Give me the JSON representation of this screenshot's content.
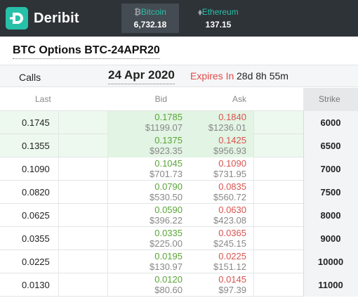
{
  "app": {
    "brand": "Deribit"
  },
  "tabs": [
    {
      "symbol": "₿",
      "label": "Bitcoin",
      "price": "6,732.18",
      "active": true
    },
    {
      "symbol": "⬧",
      "label": "Ethereum",
      "price": "137.15",
      "active": false
    }
  ],
  "page_title": "BTC Options BTC-24APR20",
  "expiry": {
    "side_label": "Calls",
    "date": "24 Apr 2020",
    "expires_in_label": "Expires In",
    "countdown": "28d 8h 55m"
  },
  "table": {
    "headers": {
      "last": "Last",
      "bid": "Bid",
      "ask": "Ask",
      "strike": "Strike"
    },
    "rows": [
      {
        "last": "0.1745",
        "bid": "0.1785",
        "bid_usd": "$1199.07",
        "ask": "0.1840",
        "ask_usd": "$1236.01",
        "strike": "6000",
        "in_the_money": true
      },
      {
        "last": "0.1355",
        "bid": "0.1375",
        "bid_usd": "$923.35",
        "ask": "0.1425",
        "ask_usd": "$956.93",
        "strike": "6500",
        "in_the_money": true
      },
      {
        "last": "0.1090",
        "bid": "0.1045",
        "bid_usd": "$701.73",
        "ask": "0.1090",
        "ask_usd": "$731.95",
        "strike": "7000",
        "in_the_money": false
      },
      {
        "last": "0.0820",
        "bid": "0.0790",
        "bid_usd": "$530.50",
        "ask": "0.0835",
        "ask_usd": "$560.72",
        "strike": "7500",
        "in_the_money": false
      },
      {
        "last": "0.0625",
        "bid": "0.0590",
        "bid_usd": "$396.22",
        "ask": "0.0630",
        "ask_usd": "$423.08",
        "strike": "8000",
        "in_the_money": false
      },
      {
        "last": "0.0355",
        "bid": "0.0335",
        "bid_usd": "$225.00",
        "ask": "0.0365",
        "ask_usd": "$245.15",
        "strike": "9000",
        "in_the_money": false
      },
      {
        "last": "0.0225",
        "bid": "0.0195",
        "bid_usd": "$130.97",
        "ask": "0.0225",
        "ask_usd": "$151.12",
        "strike": "10000",
        "in_the_money": false
      },
      {
        "last": "0.0130",
        "bid": "0.0120",
        "bid_usd": "$80.60",
        "ask": "0.0145",
        "ask_usd": "$97.39",
        "strike": "11000",
        "in_the_money": false
      }
    ]
  },
  "colors": {
    "topbar": "#2e3338",
    "brand_accent": "#27c0a8",
    "bid": "#5aa538",
    "ask": "#d9534f",
    "expires_in": "#e24b4b",
    "in_the_money_row": "#edf9ee"
  },
  "icons": {
    "brand": "deribit-logo-icon"
  }
}
